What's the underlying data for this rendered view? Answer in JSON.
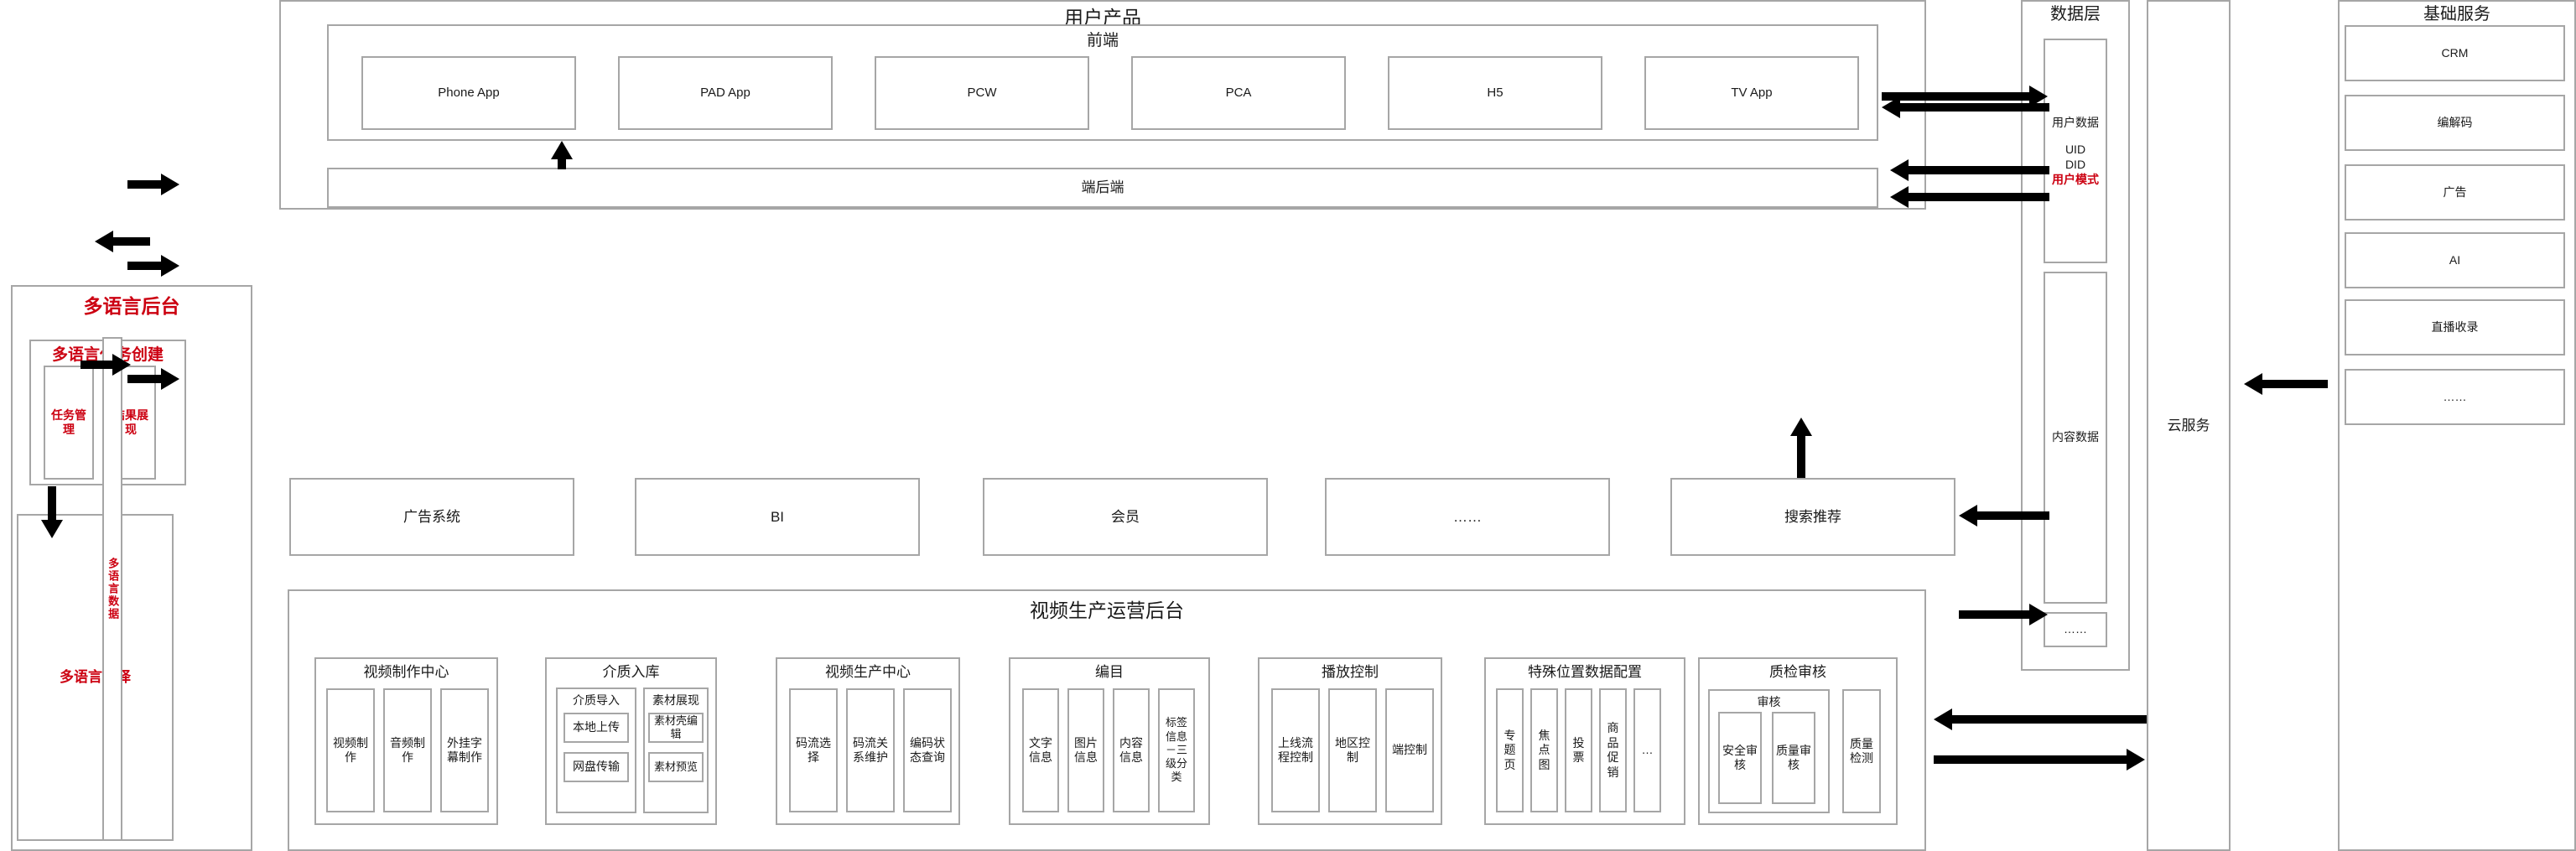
{
  "multilang": {
    "title": "多语言后台",
    "task_create": {
      "title": "多语言任务创建",
      "items": [
        "任务管理",
        "结果展现"
      ]
    },
    "translate": "多语言翻译",
    "data_column": "多语言数据"
  },
  "user_product": {
    "title": "用户产品",
    "frontend": {
      "title": "前端",
      "apps": [
        "Phone App",
        "PAD App",
        "PCW",
        "PCA",
        "H5",
        "TV App"
      ]
    },
    "backend": "端后端"
  },
  "business_systems": [
    "广告系统",
    "BI",
    "会员",
    "……",
    "搜索推荐"
  ],
  "video_ops": {
    "title": "视频生产运营后台",
    "groups": [
      {
        "title": "视频制作中心",
        "items": [
          "视频制作",
          "音频制作",
          "外挂字幕制作"
        ]
      },
      {
        "title": "介质入库",
        "subgroups": [
          {
            "title": "介质导入",
            "items": [
              "本地上传",
              "网盘传输"
            ]
          },
          {
            "title": "素材展现",
            "items": [
              "素材壳编辑",
              "素材预览"
            ]
          }
        ]
      },
      {
        "title": "视频生产中心",
        "items": [
          "码流选择",
          "码流关系维护",
          "编码状态查询"
        ]
      },
      {
        "title": "编目",
        "items": [
          "文字信息",
          "图片信息",
          "内容信息",
          "标签信息－三级分类"
        ]
      },
      {
        "title": "播放控制",
        "items": [
          "上线流程控制",
          "地区控制",
          "端控制"
        ]
      },
      {
        "title": "特殊位置数据配置",
        "items": [
          "专题页",
          "焦点图",
          "投票",
          "商品促销",
          "…"
        ]
      },
      {
        "title": "质检审核",
        "subgroups": [
          {
            "title": "审核",
            "items": [
              "安全审核",
              "质量审核"
            ]
          }
        ],
        "items": [
          "质量检测"
        ]
      }
    ]
  },
  "data_layer": {
    "title": "数据层",
    "user_data": {
      "label": "用户数据",
      "fields": [
        "UID",
        "DID"
      ],
      "highlight": "用户模式"
    },
    "content_data": "内容数据",
    "more": "……"
  },
  "cloud_service": {
    "title": "云服务"
  },
  "basic_service": {
    "title": "基础服务",
    "items": [
      "CRM",
      "编解码",
      "广告",
      "AI",
      "直播收录",
      "……"
    ]
  },
  "colors": {
    "accent_red": "#cc0011",
    "box_border": "#a6a6a6",
    "arrow": "#000000"
  }
}
